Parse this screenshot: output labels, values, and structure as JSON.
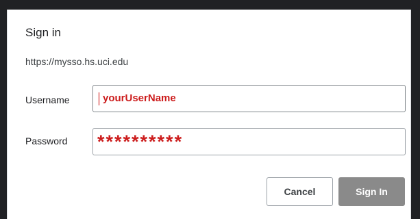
{
  "dialog": {
    "title": "Sign in",
    "url": "https://mysso.hs.uci.edu"
  },
  "form": {
    "username_label": "Username",
    "username_value": "yourUserName",
    "password_label": "Password",
    "password_value": "**********"
  },
  "buttons": {
    "cancel_label": "Cancel",
    "signin_label": "Sign In"
  },
  "colors": {
    "accent_red": "#cc1c1c",
    "signin_button_bg": "#8a8a8a"
  }
}
